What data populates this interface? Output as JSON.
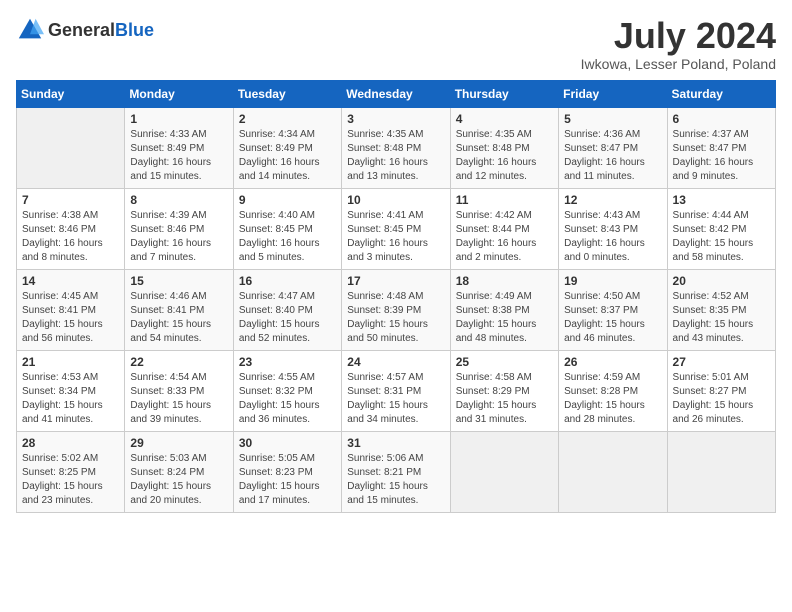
{
  "header": {
    "logo_general": "General",
    "logo_blue": "Blue",
    "month_year": "July 2024",
    "location": "Iwkowa, Lesser Poland, Poland"
  },
  "days_of_week": [
    "Sunday",
    "Monday",
    "Tuesday",
    "Wednesday",
    "Thursday",
    "Friday",
    "Saturday"
  ],
  "weeks": [
    [
      {
        "day": "",
        "sunrise": "",
        "sunset": "",
        "daylight": "",
        "empty": true
      },
      {
        "day": "1",
        "sunrise": "Sunrise: 4:33 AM",
        "sunset": "Sunset: 8:49 PM",
        "daylight": "Daylight: 16 hours and 15 minutes."
      },
      {
        "day": "2",
        "sunrise": "Sunrise: 4:34 AM",
        "sunset": "Sunset: 8:49 PM",
        "daylight": "Daylight: 16 hours and 14 minutes."
      },
      {
        "day": "3",
        "sunrise": "Sunrise: 4:35 AM",
        "sunset": "Sunset: 8:48 PM",
        "daylight": "Daylight: 16 hours and 13 minutes."
      },
      {
        "day": "4",
        "sunrise": "Sunrise: 4:35 AM",
        "sunset": "Sunset: 8:48 PM",
        "daylight": "Daylight: 16 hours and 12 minutes."
      },
      {
        "day": "5",
        "sunrise": "Sunrise: 4:36 AM",
        "sunset": "Sunset: 8:47 PM",
        "daylight": "Daylight: 16 hours and 11 minutes."
      },
      {
        "day": "6",
        "sunrise": "Sunrise: 4:37 AM",
        "sunset": "Sunset: 8:47 PM",
        "daylight": "Daylight: 16 hours and 9 minutes."
      }
    ],
    [
      {
        "day": "7",
        "sunrise": "Sunrise: 4:38 AM",
        "sunset": "Sunset: 8:46 PM",
        "daylight": "Daylight: 16 hours and 8 minutes."
      },
      {
        "day": "8",
        "sunrise": "Sunrise: 4:39 AM",
        "sunset": "Sunset: 8:46 PM",
        "daylight": "Daylight: 16 hours and 7 minutes."
      },
      {
        "day": "9",
        "sunrise": "Sunrise: 4:40 AM",
        "sunset": "Sunset: 8:45 PM",
        "daylight": "Daylight: 16 hours and 5 minutes."
      },
      {
        "day": "10",
        "sunrise": "Sunrise: 4:41 AM",
        "sunset": "Sunset: 8:45 PM",
        "daylight": "Daylight: 16 hours and 3 minutes."
      },
      {
        "day": "11",
        "sunrise": "Sunrise: 4:42 AM",
        "sunset": "Sunset: 8:44 PM",
        "daylight": "Daylight: 16 hours and 2 minutes."
      },
      {
        "day": "12",
        "sunrise": "Sunrise: 4:43 AM",
        "sunset": "Sunset: 8:43 PM",
        "daylight": "Daylight: 16 hours and 0 minutes."
      },
      {
        "day": "13",
        "sunrise": "Sunrise: 4:44 AM",
        "sunset": "Sunset: 8:42 PM",
        "daylight": "Daylight: 15 hours and 58 minutes."
      }
    ],
    [
      {
        "day": "14",
        "sunrise": "Sunrise: 4:45 AM",
        "sunset": "Sunset: 8:41 PM",
        "daylight": "Daylight: 15 hours and 56 minutes."
      },
      {
        "day": "15",
        "sunrise": "Sunrise: 4:46 AM",
        "sunset": "Sunset: 8:41 PM",
        "daylight": "Daylight: 15 hours and 54 minutes."
      },
      {
        "day": "16",
        "sunrise": "Sunrise: 4:47 AM",
        "sunset": "Sunset: 8:40 PM",
        "daylight": "Daylight: 15 hours and 52 minutes."
      },
      {
        "day": "17",
        "sunrise": "Sunrise: 4:48 AM",
        "sunset": "Sunset: 8:39 PM",
        "daylight": "Daylight: 15 hours and 50 minutes."
      },
      {
        "day": "18",
        "sunrise": "Sunrise: 4:49 AM",
        "sunset": "Sunset: 8:38 PM",
        "daylight": "Daylight: 15 hours and 48 minutes."
      },
      {
        "day": "19",
        "sunrise": "Sunrise: 4:50 AM",
        "sunset": "Sunset: 8:37 PM",
        "daylight": "Daylight: 15 hours and 46 minutes."
      },
      {
        "day": "20",
        "sunrise": "Sunrise: 4:52 AM",
        "sunset": "Sunset: 8:35 PM",
        "daylight": "Daylight: 15 hours and 43 minutes."
      }
    ],
    [
      {
        "day": "21",
        "sunrise": "Sunrise: 4:53 AM",
        "sunset": "Sunset: 8:34 PM",
        "daylight": "Daylight: 15 hours and 41 minutes."
      },
      {
        "day": "22",
        "sunrise": "Sunrise: 4:54 AM",
        "sunset": "Sunset: 8:33 PM",
        "daylight": "Daylight: 15 hours and 39 minutes."
      },
      {
        "day": "23",
        "sunrise": "Sunrise: 4:55 AM",
        "sunset": "Sunset: 8:32 PM",
        "daylight": "Daylight: 15 hours and 36 minutes."
      },
      {
        "day": "24",
        "sunrise": "Sunrise: 4:57 AM",
        "sunset": "Sunset: 8:31 PM",
        "daylight": "Daylight: 15 hours and 34 minutes."
      },
      {
        "day": "25",
        "sunrise": "Sunrise: 4:58 AM",
        "sunset": "Sunset: 8:29 PM",
        "daylight": "Daylight: 15 hours and 31 minutes."
      },
      {
        "day": "26",
        "sunrise": "Sunrise: 4:59 AM",
        "sunset": "Sunset: 8:28 PM",
        "daylight": "Daylight: 15 hours and 28 minutes."
      },
      {
        "day": "27",
        "sunrise": "Sunrise: 5:01 AM",
        "sunset": "Sunset: 8:27 PM",
        "daylight": "Daylight: 15 hours and 26 minutes."
      }
    ],
    [
      {
        "day": "28",
        "sunrise": "Sunrise: 5:02 AM",
        "sunset": "Sunset: 8:25 PM",
        "daylight": "Daylight: 15 hours and 23 minutes."
      },
      {
        "day": "29",
        "sunrise": "Sunrise: 5:03 AM",
        "sunset": "Sunset: 8:24 PM",
        "daylight": "Daylight: 15 hours and 20 minutes."
      },
      {
        "day": "30",
        "sunrise": "Sunrise: 5:05 AM",
        "sunset": "Sunset: 8:23 PM",
        "daylight": "Daylight: 15 hours and 17 minutes."
      },
      {
        "day": "31",
        "sunrise": "Sunrise: 5:06 AM",
        "sunset": "Sunset: 8:21 PM",
        "daylight": "Daylight: 15 hours and 15 minutes."
      },
      {
        "day": "",
        "sunrise": "",
        "sunset": "",
        "daylight": "",
        "empty": true
      },
      {
        "day": "",
        "sunrise": "",
        "sunset": "",
        "daylight": "",
        "empty": true
      },
      {
        "day": "",
        "sunrise": "",
        "sunset": "",
        "daylight": "",
        "empty": true
      }
    ]
  ]
}
